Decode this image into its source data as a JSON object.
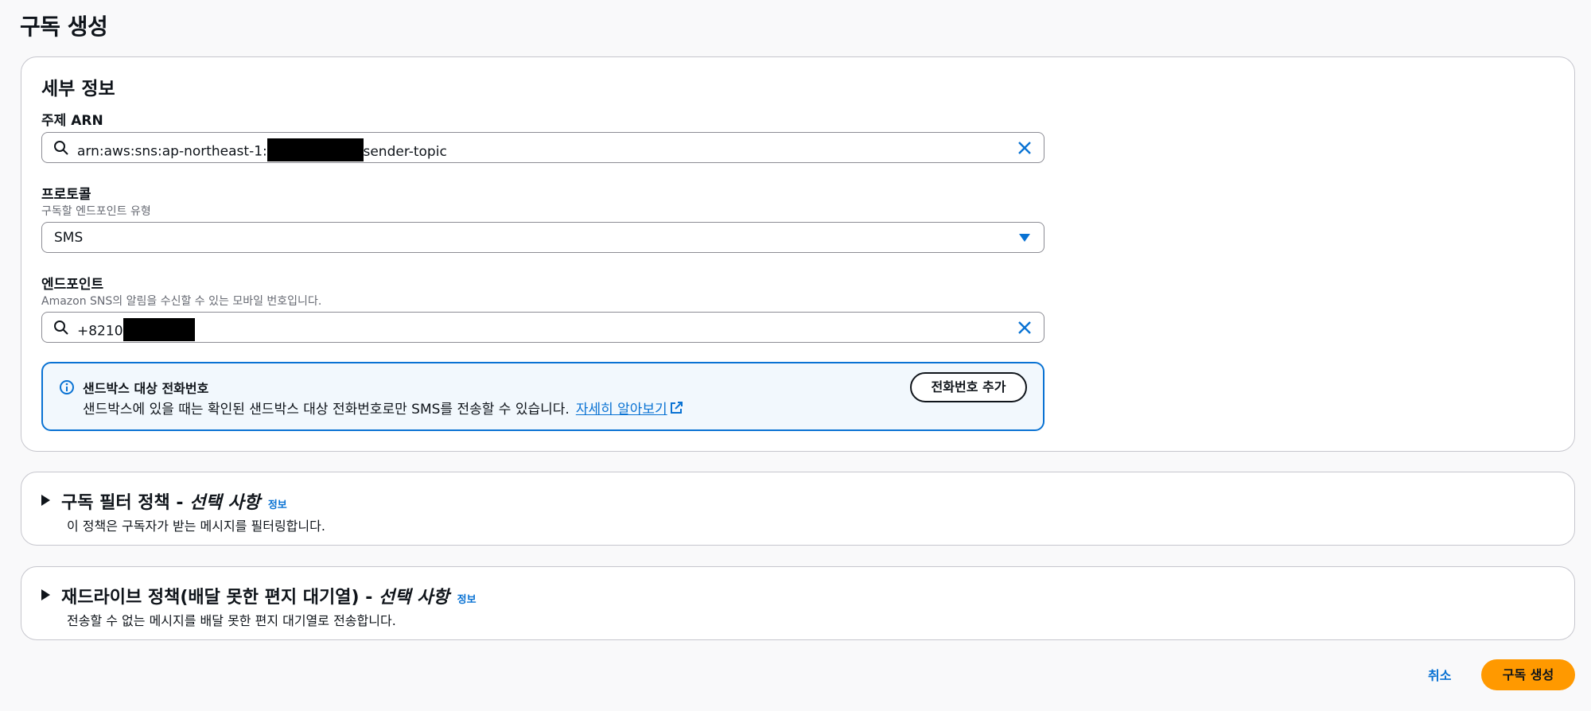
{
  "page": {
    "title": "구독 생성"
  },
  "details": {
    "title": "세부 정보",
    "topic_arn": {
      "label": "주제 ARN",
      "value_prefix": "arn:aws:sns:ap-northeast-1:",
      "value_suffix": ":sender-topic"
    },
    "protocol": {
      "label": "프로토콜",
      "description": "구독할 엔드포인트 유형",
      "value": "SMS"
    },
    "endpoint": {
      "label": "엔드포인트",
      "description": "Amazon SNS의 알림을 수신할 수 있는 모바일 번호입니다.",
      "value_prefix": "+8210"
    },
    "alert": {
      "title": "샌드박스 대상 전화번호",
      "body": "샌드박스에 있을 때는 확인된 샌드박스 대상 전화번호로만 SMS를 전송할 수 있습니다.",
      "link": "자세히 알아보기",
      "button": "전화번호 추가"
    }
  },
  "filter_policy": {
    "title": "구독 필터 정책 - ",
    "optional": "선택 사항",
    "info": "정보",
    "description": "이 정책은 구독자가 받는 메시지를 필터링합니다."
  },
  "redrive_policy": {
    "title": "재드라이브 정책(배달 못한 편지 대기열) - ",
    "optional": "선택 사항",
    "info": "정보",
    "description": "전송할 수 없는 메시지를 배달 못한 편지 대기열로 전송합니다."
  },
  "footer": {
    "cancel": "취소",
    "create": "구독 생성"
  },
  "colors": {
    "accent": "#0972d3",
    "primary_button": "#ff9900",
    "alert_bg": "#f2f8fd"
  }
}
